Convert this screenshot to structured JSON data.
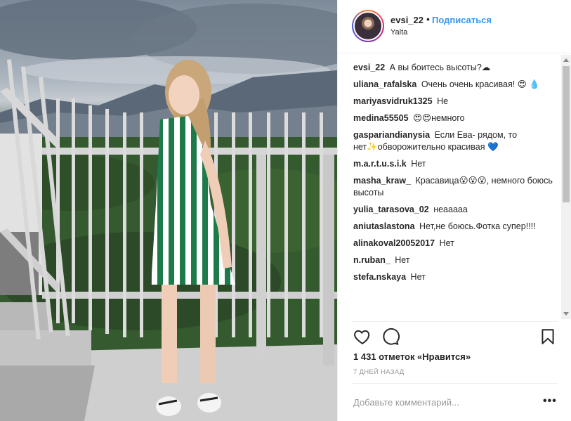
{
  "post": {
    "username": "evsi_22",
    "separator": "•",
    "follow_label": "Подписаться",
    "location": "Yalta",
    "likes": "1 431 отметок «Нравится»",
    "date": "7 ДНЕЙ НАЗАД",
    "comment_placeholder": "Добавьте комментарий...",
    "more_label": "•••"
  },
  "comments": [
    {
      "user": "evsi_22",
      "text": "А вы боитесь высоты?☁"
    },
    {
      "user": "uliana_rafalska",
      "text": "Очень очень красивая! 😍 💧"
    },
    {
      "user": "mariyasvidruk1325",
      "text": "Не"
    },
    {
      "user": "medina55505",
      "text": "😍😍немного"
    },
    {
      "user": "gaspariandianysia",
      "text": "Если Ева- рядом, то нет✨обворожительно красивая 💙"
    },
    {
      "user": "m.a.r.t.u.s.i.k",
      "text": "Нет"
    },
    {
      "user": "masha_kraw_",
      "text": "Красавица😮😮😮, немного боюсь высоты"
    },
    {
      "user": "yulia_tarasova_02",
      "text": "неааааа"
    },
    {
      "user": "aniutaslastona",
      "text": "Нет,не боюсь.Фотка супер!!!!"
    },
    {
      "user": "alinakoval20052017",
      "text": "Нет"
    },
    {
      "user": "n.ruban_",
      "text": "Нет"
    },
    {
      "user": "stefa.nskaya",
      "text": "Нет"
    }
  ],
  "icons": {
    "heart": "heart-icon",
    "comment": "comment-icon",
    "bookmark": "bookmark-icon"
  }
}
